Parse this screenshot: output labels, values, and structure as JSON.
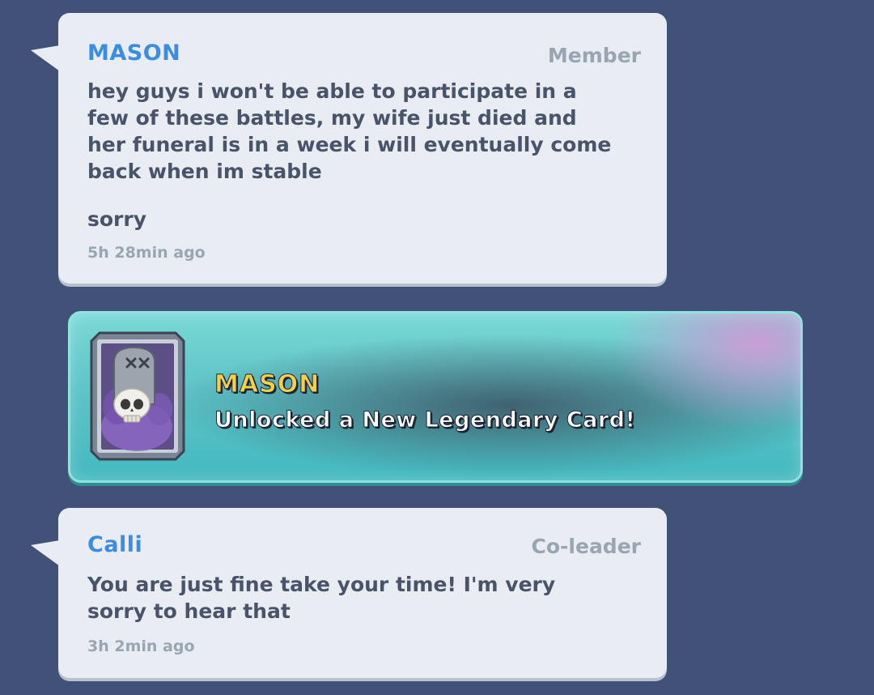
{
  "messages": [
    {
      "sender": "Mason",
      "role": "Member",
      "text": "hey guys i won't be able to participate in a\nfew of these battles, my wife just died and\nher funeral is in a week i will eventually come\nback when im stable",
      "extra": "sorry",
      "time": "5h 28min ago"
    },
    {
      "sender": "Calli",
      "role": "Co-leader",
      "text": "You are just fine take your time! I'm very\nsorry to hear that",
      "time": "3h 2min ago"
    }
  ],
  "card_unlock": {
    "player": "Mason",
    "message": "Unlocked a New Legendary Card!",
    "card_icon": "graveyard-card-icon"
  },
  "colors": {
    "background": "#415177",
    "bubble": "#e9edf3",
    "name_blue": "#3a8de0",
    "banner_teal": "#5ec4c8",
    "banner_name_gold": "#f3cf4a"
  }
}
